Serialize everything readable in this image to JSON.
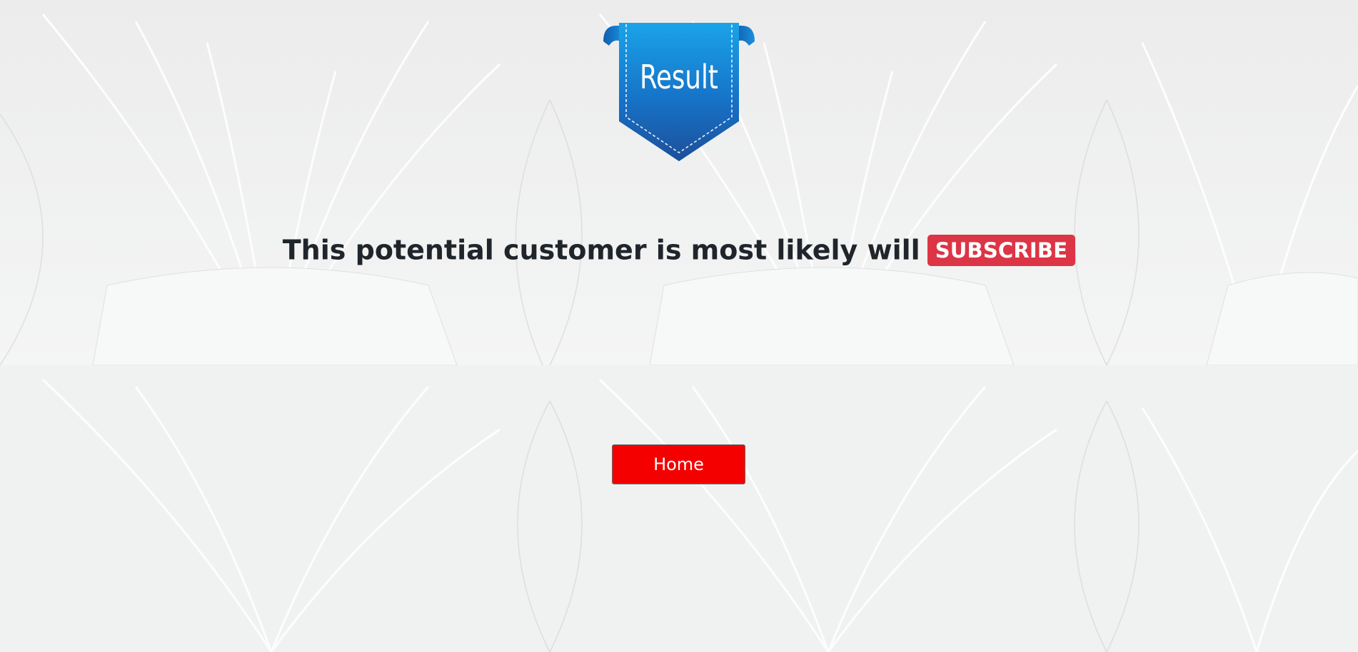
{
  "ribbon": {
    "label": "Result"
  },
  "result": {
    "text": "This potential customer is most likely will",
    "badge": "SUBSCRIBE"
  },
  "nav": {
    "home_label": "Home"
  },
  "colors": {
    "background": "#f1f2f2",
    "ribbon_blue": "#1673c8",
    "badge_red": "#dc3545",
    "button_red": "#f40000",
    "text_dark": "#1f252b"
  }
}
